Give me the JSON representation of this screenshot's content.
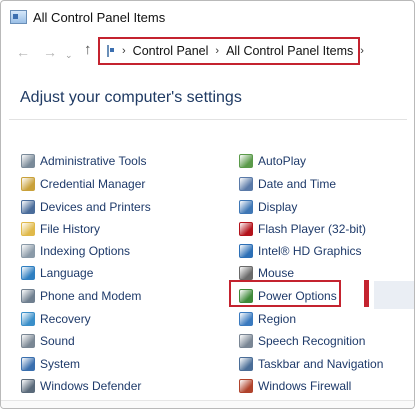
{
  "window": {
    "title": "All Control Panel Items"
  },
  "address": {
    "crumbs": [
      "Control Panel",
      "All Control Panel Items"
    ],
    "separator": "›"
  },
  "nav": {
    "back": "←",
    "forward": "→",
    "recent": "⌄",
    "up": "↑"
  },
  "heading": "Adjust your computer's settings",
  "left_items": [
    {
      "label": "Administrative Tools",
      "icon": "admin-tools-icon",
      "color": "#7a8a99"
    },
    {
      "label": "Credential Manager",
      "icon": "credential-manager-icon",
      "color": "#c9a13a"
    },
    {
      "label": "Devices and Printers",
      "icon": "devices-printers-icon",
      "color": "#4a6c9a"
    },
    {
      "label": "File History",
      "icon": "file-history-icon",
      "color": "#e0b94a"
    },
    {
      "label": "Indexing Options",
      "icon": "indexing-options-icon",
      "color": "#8a9aa8"
    },
    {
      "label": "Language",
      "icon": "language-icon",
      "color": "#2f7fc1"
    },
    {
      "label": "Phone and Modem",
      "icon": "phone-modem-icon",
      "color": "#6f7f8f"
    },
    {
      "label": "Recovery",
      "icon": "recovery-icon",
      "color": "#3a8fc9"
    },
    {
      "label": "Sound",
      "icon": "sound-icon",
      "color": "#7a8794"
    },
    {
      "label": "System",
      "icon": "system-icon",
      "color": "#3a6fae"
    },
    {
      "label": "Windows Defender",
      "icon": "windows-defender-icon",
      "color": "#5a6a7a"
    }
  ],
  "right_items": [
    {
      "label": "AutoPlay",
      "icon": "autoplay-icon",
      "color": "#5a9a4a"
    },
    {
      "label": "Date and Time",
      "icon": "date-time-icon",
      "color": "#5a7aa8"
    },
    {
      "label": "Display",
      "icon": "display-icon",
      "color": "#3f77b5"
    },
    {
      "label": "Flash Player (32-bit)",
      "icon": "flash-player-icon",
      "color": "#b3121b"
    },
    {
      "label": "Intel® HD Graphics",
      "icon": "intel-graphics-icon",
      "color": "#2c6fb6"
    },
    {
      "label": "Mouse",
      "icon": "mouse-icon",
      "color": "#6a6a6a"
    },
    {
      "label": "Power Options",
      "icon": "power-options-icon",
      "color": "#3f8a3a"
    },
    {
      "label": "Region",
      "icon": "region-icon",
      "color": "#3a7abf"
    },
    {
      "label": "Speech Recognition",
      "icon": "speech-recognition-icon",
      "color": "#7a8694"
    },
    {
      "label": "Taskbar and Navigation",
      "icon": "taskbar-navigation-icon",
      "color": "#4a6d97"
    },
    {
      "label": "Windows Firewall",
      "icon": "windows-firewall-icon",
      "color": "#b0432c"
    }
  ],
  "highlight": {
    "color": "#c4232f"
  }
}
